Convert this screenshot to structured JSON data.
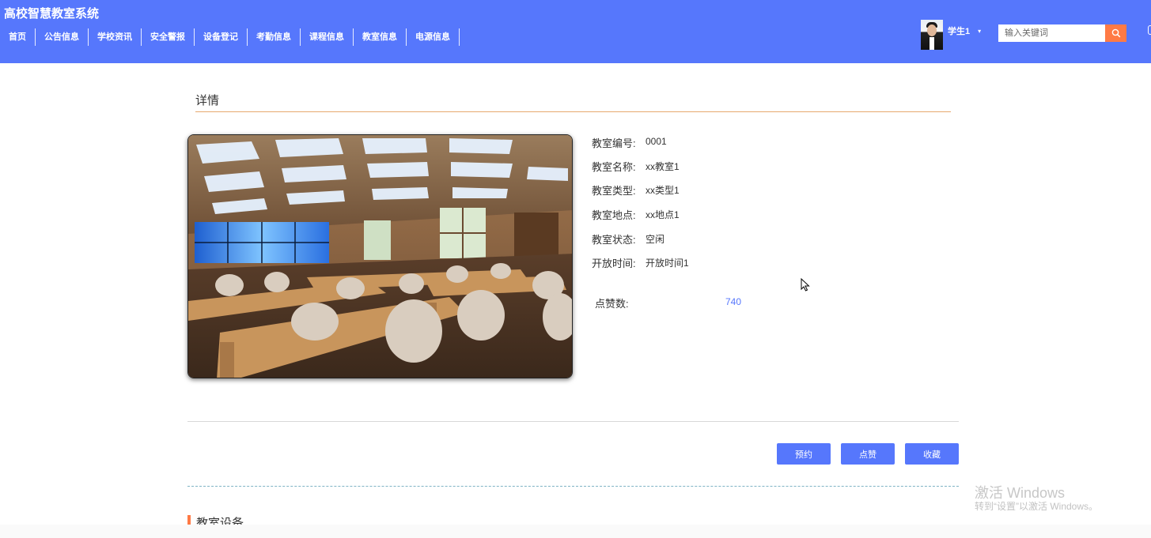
{
  "header": {
    "site_title": "高校智慧教室系统",
    "nav": [
      "首页",
      "公告信息",
      "学校资讯",
      "安全警报",
      "设备登记",
      "考勤信息",
      "课程信息",
      "教室信息",
      "电源信息"
    ],
    "user_name": "学生1",
    "user_caret": "▾",
    "search_placeholder": "输入关键词"
  },
  "detail": {
    "title": "详情",
    "fields": [
      {
        "label": "教室编号:",
        "value": "0001"
      },
      {
        "label": "教室名称:",
        "value": "xx教室1"
      },
      {
        "label": "教室类型:",
        "value": "xx类型1"
      },
      {
        "label": "教室地点:",
        "value": "xx地点1"
      },
      {
        "label": "教室状态:",
        "value": "空闲"
      },
      {
        "label": "开放时间:",
        "value": "开放时间1"
      }
    ],
    "likes_label": "点赞数:",
    "likes_value": "740"
  },
  "actions": {
    "reserve": "预约",
    "like": "点赞",
    "favorite": "收藏"
  },
  "section": {
    "title": "教室设备"
  },
  "watermark": {
    "line1": "激活 Windows",
    "line2": "转到“设置”以激活 Windows。"
  },
  "colors": {
    "header_bg": "#5677fc",
    "accent_orange": "#ff7a45",
    "button_bg": "#5677fc"
  }
}
